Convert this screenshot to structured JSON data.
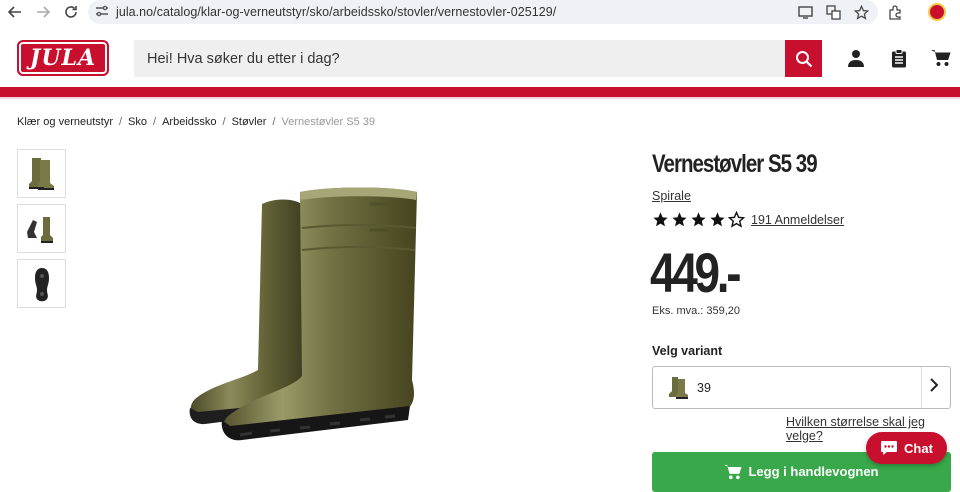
{
  "browser": {
    "back_icon": "arrow-left-icon",
    "forward_icon": "arrow-right-icon",
    "reload_icon": "reload-icon",
    "url": "jula.no/catalog/klar-og-verneutstyr/sko/arbeidssko/stovler/vernestovler-025129/"
  },
  "header": {
    "logo_text": "JULA",
    "search_placeholder": "Hei! Hva søker du etter i dag?",
    "brand_color": "#c8102e"
  },
  "breadcrumb": [
    "Klær og verneutstyr",
    "Sko",
    "Arbeidssko",
    "Støvler",
    "Vernestøvler S5 39"
  ],
  "breadcrumb_sep": "/",
  "product": {
    "title": "Vernestøvler S5 39",
    "brand": "Spirale",
    "rating": 4,
    "rating_max": 5,
    "reviews": "191 Anmeldelser",
    "price": "449.-",
    "ex_vat": "Eks. mva.: 359,20",
    "variant_label": "Velg variant",
    "variant_value": "39",
    "size_guide": "Hvilken størrelse skal jeg velge?",
    "cart_button": "Legg i handlevognen",
    "cart_color": "#38a84a"
  },
  "chat": {
    "label": "Chat"
  }
}
